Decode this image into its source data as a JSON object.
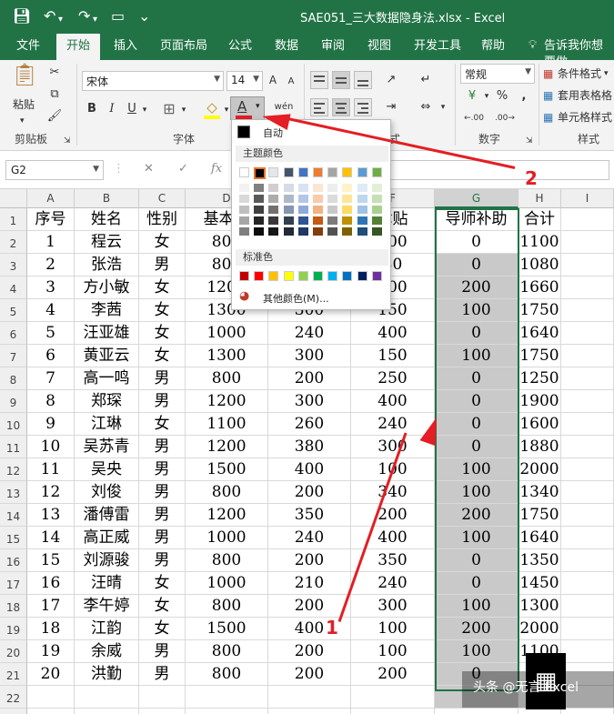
{
  "quick_access": {
    "save_icon": "save-icon",
    "undo": "↶",
    "redo": "↷",
    "open": "▭",
    "more": "⌄"
  },
  "window_title": "SAE051_三大数据隐身法.xlsx  -  Excel",
  "menus": [
    "文件",
    "开始",
    "插入",
    "页面布局",
    "公式",
    "数据",
    "审阅",
    "视图",
    "开发工具",
    "帮助"
  ],
  "tell_me": "告诉我你想要做",
  "ribbon": {
    "paste": "粘贴",
    "clipboard": "剪贴板",
    "font_name": "宋体",
    "font_size": "14",
    "bold": "B",
    "italic": "I",
    "underline": "U",
    "font_color_label": "A",
    "wen": "wén",
    "font_group": "字体",
    "align_group_tail": "式",
    "number_format": "常规",
    "percent": "%",
    "comma": ",",
    "currency": "¥",
    "dec_inc": "←.00",
    "dec_dec": ".00→",
    "number_group": "数字",
    "conditional_format": "条件格式",
    "table_format": "套用表格格",
    "cell_style": "单元格样式",
    "style_group": "样式"
  },
  "formula_bar": {
    "name_box": "G2",
    "cancel": "✕",
    "confirm": "✓",
    "fx": "fx",
    "formula": ""
  },
  "columns": [
    "A",
    "B",
    "C",
    "D",
    "E",
    "F",
    "G",
    "H",
    "I"
  ],
  "headers": [
    "序号",
    "姓名",
    "性别",
    "基本工",
    "",
    "律贴",
    "导师补助",
    "合计",
    ""
  ],
  "rows": [
    [
      "1",
      "程云",
      "女",
      "800",
      "",
      "100",
      "0",
      "1100"
    ],
    [
      "2",
      "张浩",
      "男",
      "800",
      "",
      "80",
      "0",
      "1080"
    ],
    [
      "3",
      "方小敏",
      "女",
      "1200",
      "",
      "100",
      "200",
      "1660"
    ],
    [
      "4",
      "李茜",
      "女",
      "1300",
      "300",
      "150",
      "100",
      "1750"
    ],
    [
      "5",
      "汪亚雄",
      "女",
      "1000",
      "240",
      "400",
      "0",
      "1640"
    ],
    [
      "6",
      "黄亚云",
      "女",
      "1300",
      "300",
      "150",
      "100",
      "1750"
    ],
    [
      "7",
      "高一鸣",
      "男",
      "800",
      "200",
      "250",
      "0",
      "1250"
    ],
    [
      "8",
      "郑琛",
      "男",
      "1200",
      "300",
      "400",
      "0",
      "1900"
    ],
    [
      "9",
      "江琳",
      "女",
      "1100",
      "260",
      "240",
      "0",
      "1600"
    ],
    [
      "10",
      "吴苏青",
      "男",
      "1200",
      "380",
      "300",
      "0",
      "1880"
    ],
    [
      "11",
      "吴央",
      "男",
      "1500",
      "400",
      "100",
      "100",
      "2000"
    ],
    [
      "12",
      "刘俊",
      "男",
      "800",
      "200",
      "340",
      "100",
      "1340"
    ],
    [
      "13",
      "潘傅雷",
      "男",
      "1200",
      "350",
      "200",
      "200",
      "1750"
    ],
    [
      "14",
      "高正威",
      "男",
      "1000",
      "240",
      "400",
      "100",
      "1640"
    ],
    [
      "15",
      "刘源骏",
      "男",
      "800",
      "200",
      "350",
      "0",
      "1350"
    ],
    [
      "16",
      "汪晴",
      "女",
      "1000",
      "210",
      "240",
      "0",
      "1450"
    ],
    [
      "17",
      "李午婷",
      "女",
      "800",
      "200",
      "300",
      "100",
      "1300"
    ],
    [
      "18",
      "江韵",
      "女",
      "1500",
      "400",
      "100",
      "200",
      "2000"
    ],
    [
      "19",
      "余威",
      "男",
      "800",
      "200",
      "100",
      "100",
      "1100"
    ],
    [
      "20",
      "洪勤",
      "男",
      "800",
      "200",
      "200",
      "0",
      ""
    ]
  ],
  "row_numbers": [
    "1",
    "2",
    "3",
    "4",
    "5",
    "6",
    "7",
    "8",
    "9",
    "10",
    "11",
    "12",
    "13",
    "14",
    "15",
    "16",
    "17",
    "18",
    "19",
    "20",
    "21",
    "22",
    "23"
  ],
  "color_menu": {
    "auto": "自动",
    "theme_colors": "主题颜色",
    "standard_colors": "标准色",
    "more_colors": "其他颜色(M)...",
    "theme_top": [
      "#ffffff",
      "#000000",
      "#e7e6e6",
      "#44546a",
      "#4472c4",
      "#ed7d31",
      "#a5a5a5",
      "#ffc000",
      "#5b9bd5",
      "#70ad47"
    ],
    "theme_shades": [
      [
        "#f2f2f2",
        "#808080",
        "#d0cece",
        "#d6dce4",
        "#d9e2f3",
        "#fbe5d5",
        "#ededed",
        "#fff2cc",
        "#deebf6",
        "#e2efd9"
      ],
      [
        "#d9d9d9",
        "#595959",
        "#aeabab",
        "#adb9ca",
        "#b4c6e7",
        "#f7cbac",
        "#dbdbdb",
        "#fee599",
        "#bdd7ee",
        "#c5e0b3"
      ],
      [
        "#bfbfbf",
        "#404040",
        "#757070",
        "#8496b0",
        "#8eaadb",
        "#f4b183",
        "#c9c9c9",
        "#ffd966",
        "#9dc3e6",
        "#a8d08d"
      ],
      [
        "#a6a6a6",
        "#262626",
        "#3a3838",
        "#323f4f",
        "#2f5496",
        "#c55a11",
        "#7b7b7b",
        "#bf9000",
        "#2e75b5",
        "#538135"
      ],
      [
        "#7f7f7f",
        "#0d0d0d",
        "#171616",
        "#222a35",
        "#1f3864",
        "#843c0b",
        "#525252",
        "#7f6000",
        "#1e4e79",
        "#375623"
      ]
    ],
    "standard": [
      "#c00000",
      "#ff0000",
      "#ffc000",
      "#ffff00",
      "#92d050",
      "#00b050",
      "#00b0f0",
      "#0070c0",
      "#002060",
      "#7030a0"
    ]
  },
  "annotations": {
    "label_1": "1",
    "label_2": "2"
  },
  "watermark": "头条 @无言 Excel",
  "colors": {
    "excel_green": "#217346",
    "highlight": "#c9c9c9",
    "arrow_red": "#e31e24"
  }
}
